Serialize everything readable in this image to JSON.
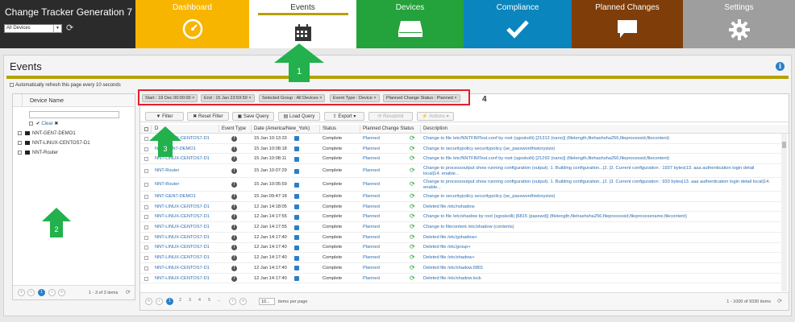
{
  "app": {
    "title": "Change Tracker Generation 7",
    "device_select": "All Devices"
  },
  "nav": [
    {
      "label": "Dashboard"
    },
    {
      "label": "Events"
    },
    {
      "label": "Devices"
    },
    {
      "label": "Compliance"
    },
    {
      "label": "Planned Changes"
    },
    {
      "label": "Settings"
    }
  ],
  "page": {
    "title": "Events",
    "autorefresh": "Automatically refresh this page every 10 seconds"
  },
  "callouts": [
    "1",
    "2",
    "3",
    "4"
  ],
  "device_panel": {
    "column_header": "Device Name",
    "clear_label": "Clear",
    "devices": [
      "NNT-GEN7-DEMO1",
      "NNT-LINUX-CENTOS7-D1",
      "NNT-Router"
    ],
    "pager": {
      "pages": [
        "1"
      ],
      "current": "1",
      "count": "1 - 3 of 3 items"
    }
  },
  "filter_chips": [
    "Start : 19 Dec 00:00:00",
    "End : 15 Jan 23:59:59",
    "Selected Group : All Devices",
    "Event Type : Device",
    "Planned Change Status : Planned"
  ],
  "toolbar": {
    "filter": "Filter",
    "reset_filter": "Reset Filter",
    "save_query": "Save Query",
    "load_query": "Load Query",
    "export": "Export",
    "resubmit": "Resubmit",
    "actions": "Actions"
  },
  "grid": {
    "columns": [
      "D",
      "Event Type",
      "Date (America/New_York)",
      "Status",
      "Planned Change Status",
      "Description"
    ],
    "rows": [
      {
        "device": "NNT-LINUX-CENTOS7-D1",
        "date": "15 Jan 10:13:33",
        "status": "Complete",
        "pcs": "Planned",
        "desc": "Change to file /etc/NNTFIMTest.conf by root (sgoskolli) [21312 (nano)] (filelength,filehashsha256,fileprocessid,filecontent)"
      },
      {
        "device": "NNT-GEN7-DEMO1",
        "date": "15 Jan 10:08:18",
        "status": "Complete",
        "pcs": "Planned",
        "desc": "Change to securitypolicy securitypolicy (se_passwordhistorysize)"
      },
      {
        "device": "NNT-LINUX-CENTOS7-D1",
        "date": "15 Jan 10:08:11",
        "status": "Complete",
        "pcs": "Planned",
        "desc": "Change to file /etc/NNTFIMTest.conf by root (sgoskolli) [21292 (nano)] (filelength,filehashsha256,fileprocessid,filecontent)"
      },
      {
        "device": "NNT-Router",
        "date": "15 Jan 10:07:29",
        "status": "Complete",
        "pcs": "Planned",
        "desc": "Change to processoutput show running configuration (output). 1. Building configuration...|2. |3. Current configuration : 1937 bytes|13. aaa authentication login detail local|14. enable..."
      },
      {
        "device": "NNT-Router",
        "date": "15 Jan 10:05:59",
        "status": "Complete",
        "pcs": "Planned",
        "desc": "Change to processoutput show running configuration (output). 1. Building configuration...|2. |3. Current configuration : 933 bytes|13. aaa authentication login detail local|14. enable..."
      },
      {
        "device": "NNT-GEN7-DEMO1",
        "date": "15 Jan 09:47:18",
        "status": "Complete",
        "pcs": "Planned",
        "desc": "Change to securitypolicy securitypolicy (se_passwordhistorysize)"
      },
      {
        "device": "NNT-LINUX-CENTOS7-D1",
        "date": "12 Jan 14:18:05",
        "status": "Complete",
        "pcs": "Planned",
        "desc": "Deleted file /etc/nshadow"
      },
      {
        "device": "NNT-LINUX-CENTOS7-D1",
        "date": "12 Jan 14:17:55",
        "status": "Complete",
        "pcs": "Planned",
        "desc": "Change to file /etc/shadow by root (sgoskolli) [6815 (passwd)] (filelength,filehashsha256,fileprocessid,fileprocessname,filecontent)"
      },
      {
        "device": "NNT-LINUX-CENTOS7-D1",
        "date": "12 Jan 14:17:55",
        "status": "Complete",
        "pcs": "Planned",
        "desc": "Change to filecontent /etc/shadow (contents)"
      },
      {
        "device": "NNT-LINUX-CENTOS7-D1",
        "date": "12 Jan 14:17:40",
        "status": "Complete",
        "pcs": "Planned",
        "desc": "Deleted file /etc/gshadow+"
      },
      {
        "device": "NNT-LINUX-CENTOS7-D1",
        "date": "12 Jan 14:17:40",
        "status": "Complete",
        "pcs": "Planned",
        "desc": "Deleted file /etc/group+"
      },
      {
        "device": "NNT-LINUX-CENTOS7-D1",
        "date": "12 Jan 14:17:40",
        "status": "Complete",
        "pcs": "Planned",
        "desc": "Deleted file /etc/shadow+"
      },
      {
        "device": "NNT-LINUX-CENTOS7-D1",
        "date": "12 Jan 14:17:40",
        "status": "Complete",
        "pcs": "Planned",
        "desc": "Deleted file /etc/shadow.6801"
      },
      {
        "device": "NNT-LINUX-CENTOS7-D1",
        "date": "12 Jan 14:17:40",
        "status": "Complete",
        "pcs": "Planned",
        "desc": "Deleted file /etc/shadow.lock"
      }
    ],
    "pager": {
      "pages": [
        "1",
        "2",
        "3",
        "4",
        "5",
        "..."
      ],
      "current": "1",
      "per_page": "10...",
      "per_page_label": "items per page",
      "count": "1 - 1000 of 9330 items"
    }
  },
  "colors": {
    "dashboard": "#f7b500",
    "devices": "#24a23b",
    "compliance": "#0a85bd",
    "planned": "#7f3e09",
    "settings": "#9e9e9e",
    "highlight": "#e2202a",
    "callout": "#22b14c"
  }
}
